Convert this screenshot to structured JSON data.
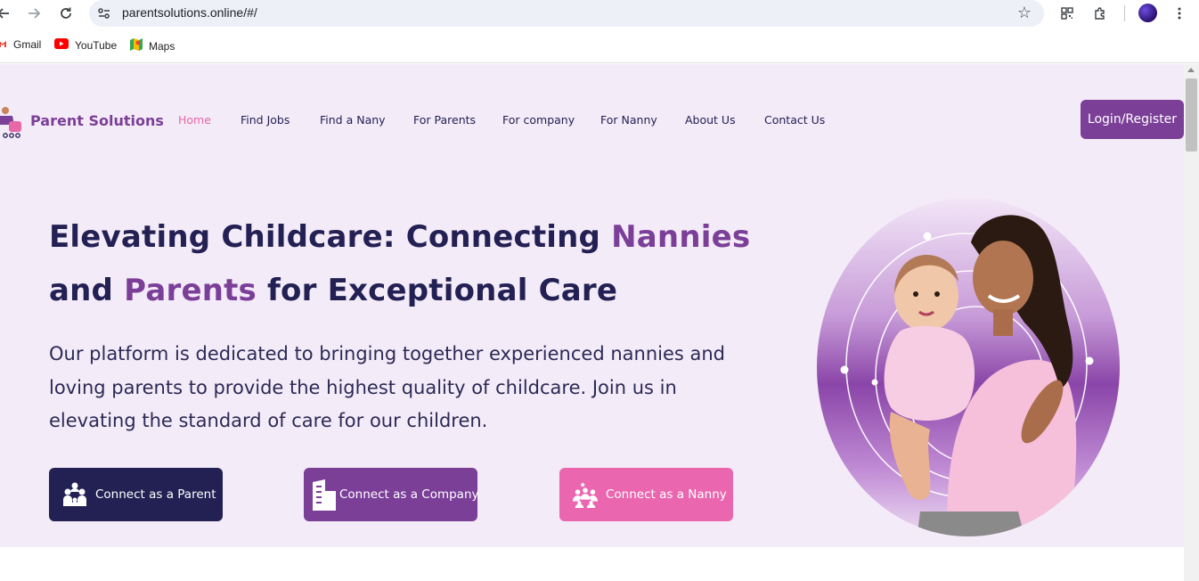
{
  "browser": {
    "url": "parentsolutions.online/#/",
    "bookmarks": [
      {
        "label": "Gmail",
        "icon": "gmail-icon"
      },
      {
        "label": "YouTube",
        "icon": "youtube-icon"
      },
      {
        "label": "Maps",
        "icon": "maps-icon"
      }
    ]
  },
  "header": {
    "logo_text": "Parent Solutions",
    "nav": [
      {
        "label": "Home",
        "active": true
      },
      {
        "label": "Find Jobs"
      },
      {
        "label": "Find a Nany"
      },
      {
        "label": "For Parents"
      },
      {
        "label": "For company"
      },
      {
        "label": "For Nanny"
      },
      {
        "label": "About Us"
      },
      {
        "label": "Contact Us"
      }
    ],
    "login_label": "Login/Register"
  },
  "hero": {
    "title_part1": "Elevating Childcare: Connecting ",
    "title_accent1": "Nannies",
    "title_part2": "and ",
    "title_accent2": "Parents",
    "title_part3": " for Exceptional Care",
    "description": "Our platform is dedicated to bringing together experienced nannies and loving parents to provide the highest quality of childcare. Join us in elevating the standard of care for our children.",
    "buttons": [
      {
        "label": "Connect as a Parent",
        "icon": "family-icon",
        "color": "#232054"
      },
      {
        "label": "Connect as a Company",
        "icon": "building-icon",
        "color": "#7b3f98"
      },
      {
        "label": "Connect as a Nanny",
        "icon": "group-icon",
        "color": "#ea67b0"
      }
    ]
  },
  "colors": {
    "brand_purple": "#7b3f98",
    "navy": "#232054",
    "pink": "#ea67b0",
    "page_bg": "#f4ebf8"
  }
}
